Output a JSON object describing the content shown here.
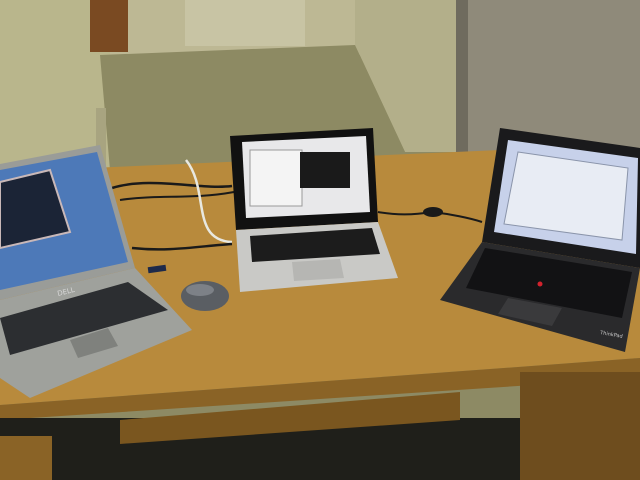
{
  "scene": {
    "palette": {
      "wall": "#b9b68c",
      "wall_shadow": "#a19e77",
      "carpet": "#8d8a63",
      "door": "#c8c4a4",
      "cubicle_panel": "#8f8a7a",
      "desk_top": "#b88a3c",
      "desk_edge": "#8a6326",
      "desk_front": "#6e4d1e",
      "dark_floor": "#1f1f1a",
      "cable": "#1a1a1a",
      "cable_white": "#e8e8e0"
    },
    "laptops": [
      {
        "brand_label": "DELL",
        "body_color": "#9a9c98",
        "screen_color": "#4d79b8",
        "wallpaper_color": "#6f93c6"
      },
      {
        "brand_label": "",
        "body_color": "#c9c9c6",
        "screen_color": "#e8e8ea",
        "bezel_color": "#111111"
      },
      {
        "brand_label": "ThinkPad",
        "body_color": "#2a2a2c",
        "screen_color": "#c7d1ea",
        "bezel_color": "#1a1a1c"
      }
    ],
    "mouse": {
      "color": "#5a5e63"
    }
  }
}
